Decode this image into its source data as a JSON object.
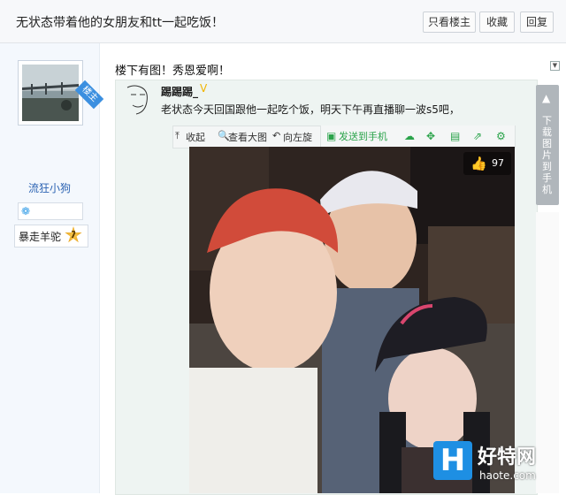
{
  "header": {
    "title": "无状态带着他的女朋友和tt一起吃饭！",
    "buttons": [
      "只看楼主",
      "收藏",
      "回复"
    ]
  },
  "author": {
    "louzhu_tag": "楼主",
    "username": "流狂小狗",
    "badge_name": "暴走羊驼",
    "badge_level": "7"
  },
  "post": {
    "text": "楼下有图！秀恩爱啊！",
    "collapse_icon": "▼"
  },
  "weibo": {
    "handle": "踢踢踢_",
    "vip_icon": "V",
    "text": "老状态今天回国跟他一起吃个饭，明天下午再直播聊一波s5吧，",
    "toolbar": {
      "collapse_label": "收起",
      "view_large_label": "查看大图",
      "rotate_left_label": "向左旋",
      "send_to_phone_label": "发送到手机"
    },
    "likes": "97"
  },
  "side_download": {
    "text": "下载图片到手机"
  },
  "watermark": {
    "logo_letter": "H",
    "logo_cn": "好特网",
    "logo_url": "haote.com"
  },
  "colors": {
    "accent_blue": "#3b8fe0",
    "username_blue": "#2d64b3",
    "toolbar_green": "#2aa34a"
  }
}
